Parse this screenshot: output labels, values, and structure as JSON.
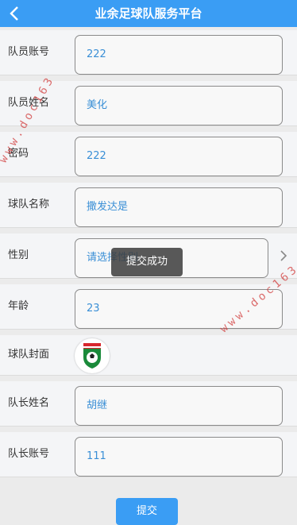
{
  "header": {
    "title": "业余足球队服务平台",
    "back_icon": "chevron-left-icon"
  },
  "fields": [
    {
      "label": "队员账号",
      "value": "222"
    },
    {
      "label": "队员姓名",
      "value": "美化"
    },
    {
      "label": "密码",
      "value": "222"
    },
    {
      "label": "球队名称",
      "value": "撒发达是"
    },
    {
      "label": "性别",
      "value": "请选择性别"
    },
    {
      "label": "年龄",
      "value": "23"
    },
    {
      "label": "球队封面",
      "value": ""
    },
    {
      "label": "队长姓名",
      "value": "胡继"
    },
    {
      "label": "队长账号",
      "value": "111"
    }
  ],
  "toast": {
    "text": "提交成功"
  },
  "submit": {
    "label": "提交"
  },
  "watermark": {
    "text_left": "www.doc163",
    "text_right": "www.doc163"
  },
  "colors": {
    "accent": "#3a9df4",
    "value_text": "#3a8fd6",
    "toast_bg": "#3c3c3c"
  }
}
